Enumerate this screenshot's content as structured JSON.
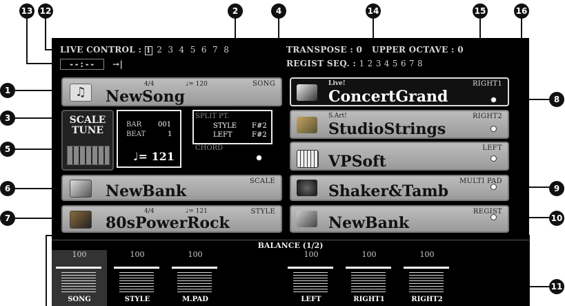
{
  "callouts": {
    "c1": "1",
    "c2": "2",
    "c3": "3",
    "c4": "4",
    "c5": "5",
    "c6": "6",
    "c7": "7",
    "c8": "8",
    "c9": "9",
    "c10": "10",
    "c11": "11",
    "c12": "12",
    "c13": "13",
    "c14": "14",
    "c15": "15",
    "c16": "16"
  },
  "header": {
    "live_control_label": "LIVE CONTROL :",
    "live_control_selected": "1",
    "live_control_others": "2  3  4  5  6  7  8",
    "time_display": "--:--",
    "time_end_icon": "→|",
    "transpose_label": "TRANSPOSE : 0",
    "upper_octave_label": "UPPER OCTAVE : 0",
    "regist_seq_label": "REGIST SEQ. :",
    "regist_seq_numbers": "1 2 3 4 5 6 7 8"
  },
  "song": {
    "time_sig": "4/4",
    "tempo": "♩= 120",
    "tag": "SONG",
    "name": "NewSong",
    "icon": "music-note-icon"
  },
  "scale_tune": {
    "line1": "SCALE",
    "line2": "TUNE"
  },
  "bar_beat": {
    "bar_label": "BAR",
    "bar_value": "001",
    "beat_label": "BEAT",
    "beat_value": "1",
    "tempo": "♩= 121"
  },
  "split_pt": {
    "title": "SPLIT PT.",
    "style_label": "STYLE",
    "style_value": "F#2",
    "left_label": "LEFT",
    "left_value": "F#2",
    "chord_label": "CHORD"
  },
  "scale": {
    "tag": "SCALE",
    "name": "NewBank"
  },
  "style": {
    "time_sig": "4/4",
    "tempo": "♩= 121",
    "tag": "STYLE",
    "name": "80sPowerRock"
  },
  "right1": {
    "sub": "Live!",
    "tag": "RIGHT1",
    "name": "ConcertGrand"
  },
  "right2": {
    "sub": "S.Art!",
    "tag": "RIGHT2",
    "name": "StudioStrings"
  },
  "left": {
    "tag": "LEFT",
    "name": "VPSoft"
  },
  "multipad": {
    "tag": "MULTI PAD",
    "name": "Shaker&Tamb"
  },
  "regist": {
    "tag": "REGIST",
    "name": "NewBank"
  },
  "balance": {
    "title": "BALANCE (1/2)",
    "channels": [
      {
        "value": "100",
        "label": "SONG",
        "level": 1.0
      },
      {
        "value": "100",
        "label": "STYLE",
        "level": 1.0
      },
      {
        "value": "100",
        "label": "M.PAD",
        "level": 1.0
      },
      {
        "value": "100",
        "label": "LEFT",
        "level": 1.0
      },
      {
        "value": "100",
        "label": "RIGHT1",
        "level": 1.0
      },
      {
        "value": "100",
        "label": "RIGHT2",
        "level": 1.0
      }
    ]
  }
}
